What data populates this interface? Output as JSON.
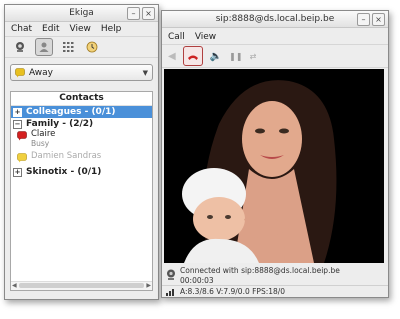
{
  "contacts_window": {
    "title": "Ekiga",
    "menu": [
      "Chat",
      "Edit",
      "View",
      "Help"
    ],
    "presence": {
      "label": "Away"
    },
    "roster": {
      "header": "Contacts",
      "groups": [
        {
          "label": "Colleagues - (0/1)",
          "expanded": false,
          "selected": true
        },
        {
          "label": "Family - (2/2)",
          "expanded": true,
          "selected": false
        },
        {
          "label": "Skinotix - (0/1)",
          "expanded": false,
          "selected": false
        }
      ],
      "contacts": [
        {
          "name": "Claire",
          "status": "Busy"
        },
        {
          "name": "Damien Sandras",
          "status": ""
        }
      ]
    }
  },
  "call_window": {
    "title": "sip:8888@ds.local.beip.be",
    "menu": [
      "Call",
      "View"
    ],
    "status": {
      "line1": "Connected with sip:8888@ds.local.beip.be",
      "line2": "00:00:03"
    },
    "codec_info": "A:8.3/8.6 V:7.9/0.0 FPS:18/0"
  },
  "colors": {
    "selection": "#4a90d9",
    "busy": "#d42020",
    "away": "#e8c020",
    "hangup": "#cc2222"
  }
}
